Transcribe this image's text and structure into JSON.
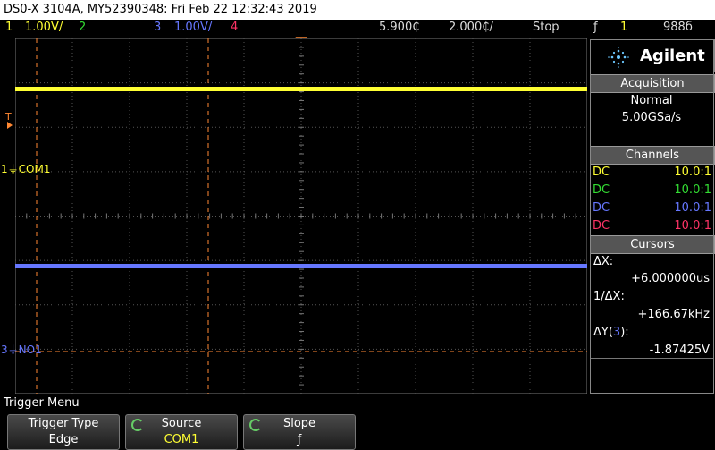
{
  "title": "DS0-X 3104A, MY52390348: Fri Feb 22 12:32:43 2019",
  "status": {
    "ch1_num": "1",
    "ch1_scale": "1.00V/",
    "ch2_num": "2",
    "ch3_num": "3",
    "ch3_scale": "1.00V/",
    "ch4_num": "4",
    "time_delay": "5.900₵",
    "time_scale": "2.000₵/",
    "run_state": "Stop",
    "trig_icon": "ƒ",
    "trig_src": "1",
    "trig_level": "988б"
  },
  "colors": {
    "ch1": "#ffff33",
    "ch2": "#33dd33",
    "ch3": "#6677ff",
    "ch4": "#ff3366",
    "cursor": "#ff8833",
    "grid": "#555555"
  },
  "markers": {
    "trig_t": "T",
    "ch1_label": "COM1",
    "ch1_num": "1",
    "ch3_label": "NO1",
    "ch3_num": "3"
  },
  "panel": {
    "brand": "Agilent",
    "acq_header": "Acquisition",
    "acq_mode": "Normal",
    "acq_rate": "5.00GSa/s",
    "channels_header": "Channels",
    "channels": [
      {
        "coupling": "DC",
        "probe": "10.0:1",
        "color": "#ffff33"
      },
      {
        "coupling": "DC",
        "probe": "10.0:1",
        "color": "#33dd33"
      },
      {
        "coupling": "DC",
        "probe": "10.0:1",
        "color": "#6677ff"
      },
      {
        "coupling": "DC",
        "probe": "10.0:1",
        "color": "#ff3366"
      }
    ],
    "cursors_header": "Cursors",
    "dx_label": "ΔX:",
    "dx_value": "+6.000000us",
    "inv_dx_label": "1/ΔX:",
    "inv_dx_value": "+166.67kHz",
    "dy_label": "ΔY(",
    "dy_ch": "3",
    "dy_close": "):",
    "dy_value": "-1.87425V"
  },
  "menu": {
    "title": "Trigger Menu",
    "keys": [
      {
        "title": "Trigger Type",
        "value": "Edge"
      },
      {
        "title": "Source",
        "value": "COM1"
      },
      {
        "title": "Slope",
        "value": "ƒ"
      }
    ]
  }
}
